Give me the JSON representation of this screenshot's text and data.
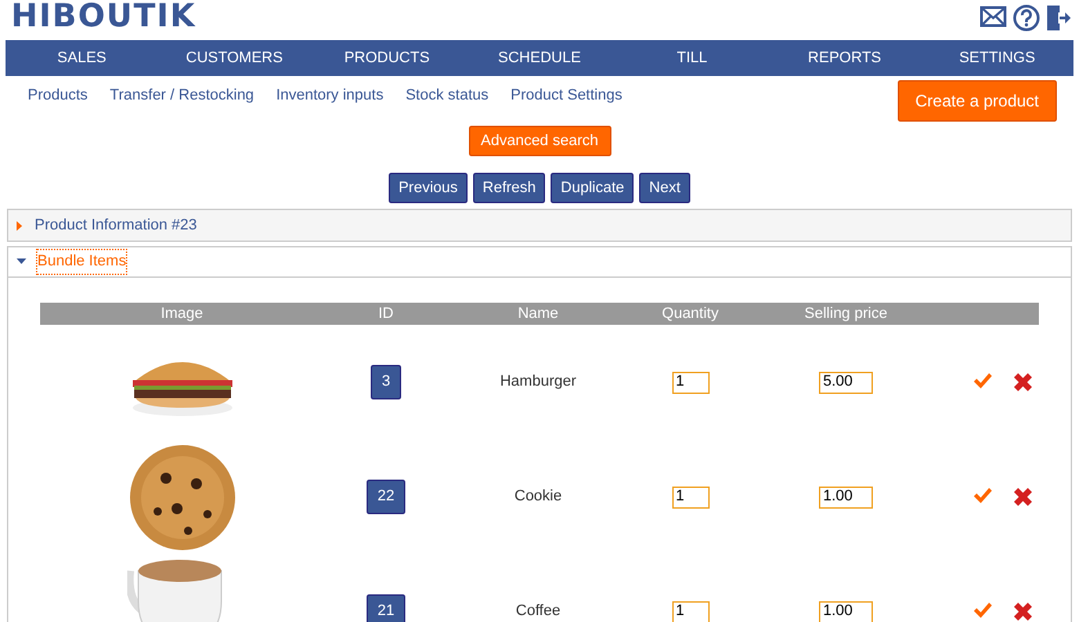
{
  "logo": "HIBOUTIK",
  "main_nav": [
    {
      "label": "SALES"
    },
    {
      "label": "CUSTOMERS"
    },
    {
      "label": "PRODUCTS"
    },
    {
      "label": "SCHEDULE"
    },
    {
      "label": "TILL"
    },
    {
      "label": "REPORTS"
    },
    {
      "label": "SETTINGS"
    }
  ],
  "sub_nav": [
    "Products",
    "Transfer / Restocking",
    "Inventory inputs",
    "Stock status",
    "Product Settings"
  ],
  "create_button": "Create a product",
  "advanced_search": "Advanced search",
  "record_buttons": [
    "Previous",
    "Refresh",
    "Duplicate",
    "Next"
  ],
  "panels": [
    {
      "title": "Product Information #23",
      "expanded": false
    },
    {
      "title": "Bundle Items",
      "expanded": true
    }
  ],
  "table": {
    "columns": [
      "Image",
      "ID",
      "Name",
      "Quantity",
      "Selling price"
    ],
    "rows": [
      {
        "id": "3",
        "name": "Hamburger",
        "quantity": "1",
        "price": "5.00"
      },
      {
        "id": "22",
        "name": "Cookie",
        "quantity": "1",
        "price": "1.00"
      },
      {
        "id": "21",
        "name": "Coffee",
        "quantity": "1",
        "price": "1.00"
      }
    ]
  }
}
